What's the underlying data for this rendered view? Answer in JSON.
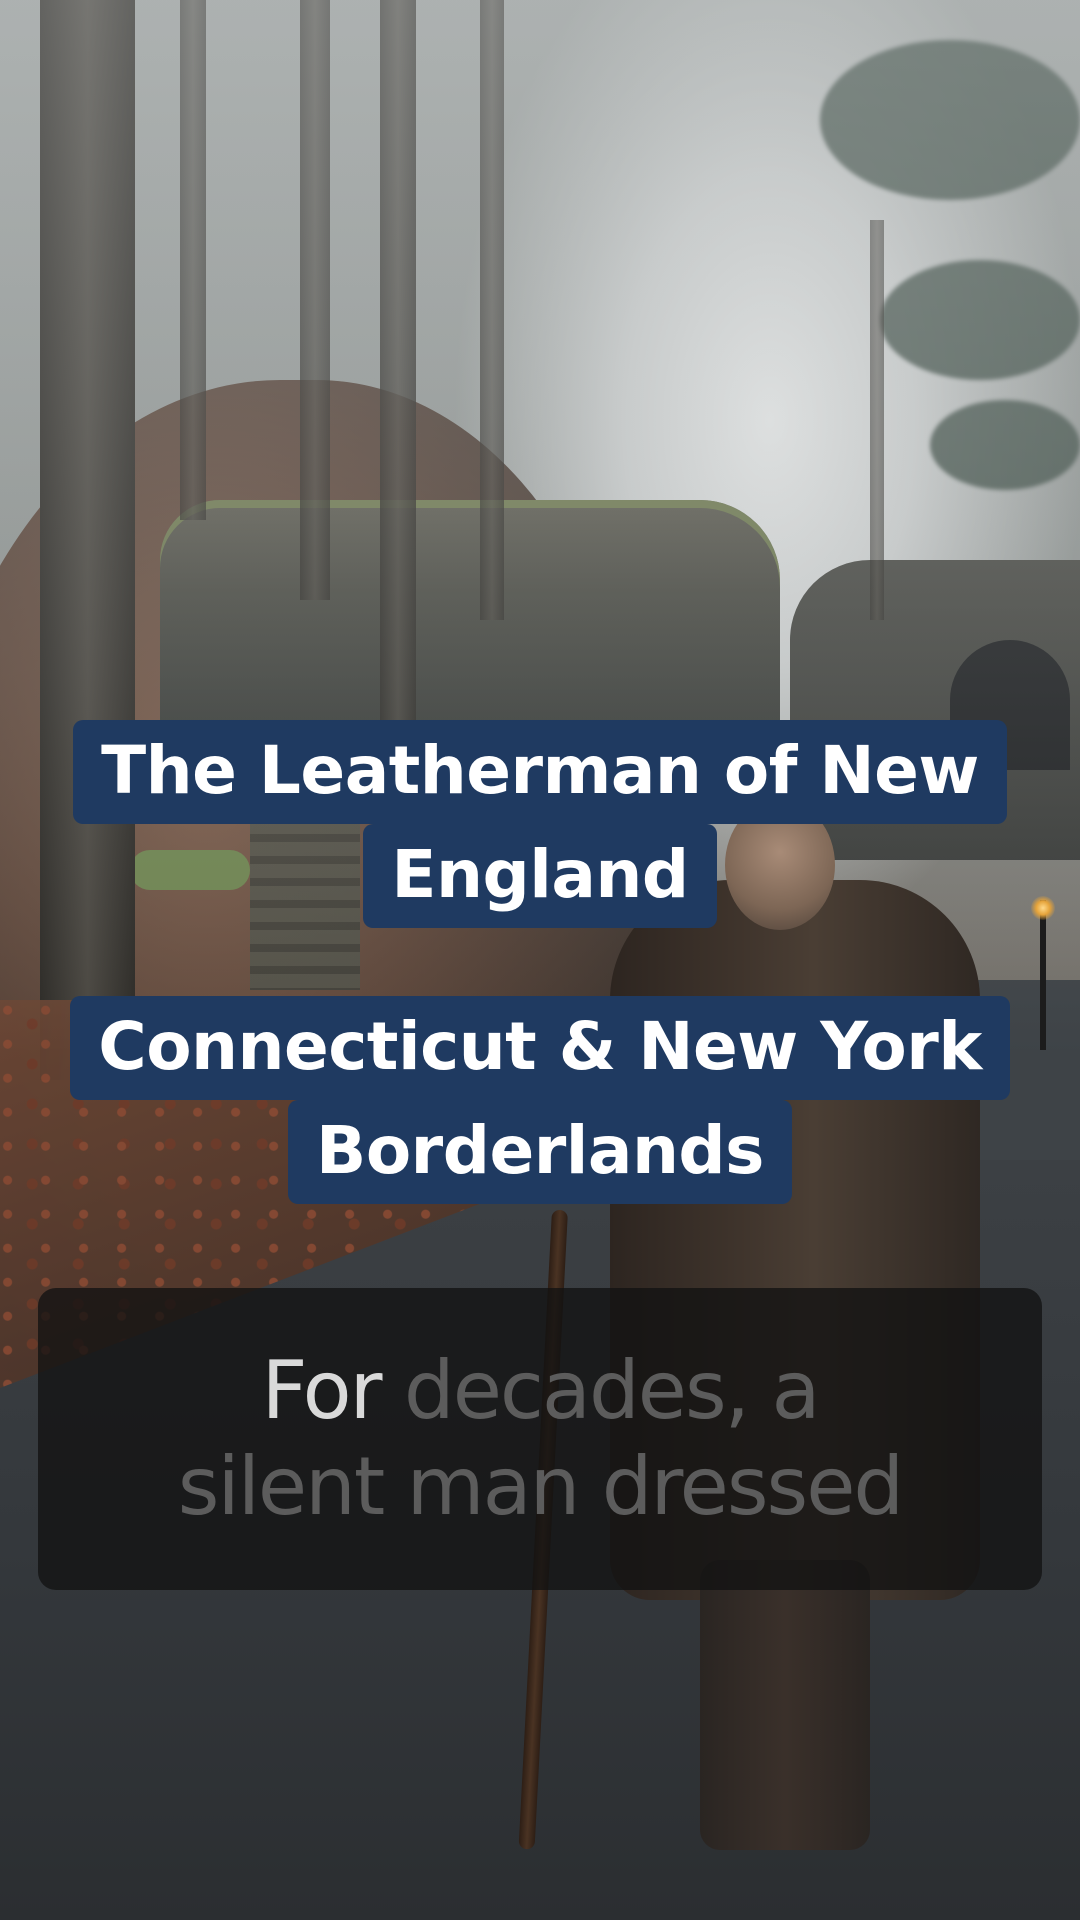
{
  "title_card": {
    "line1": "The Leatherman of New",
    "line2": "England"
  },
  "location_card": {
    "line1": "Connecticut & New York",
    "line2": "Borderlands"
  },
  "caption": {
    "spoken_word": "For",
    "line1_rest": " decades, a",
    "line2": "silent man dressed"
  },
  "colors": {
    "title_bg": "#1f3a61",
    "title_text": "#ffffff",
    "caption_active": "#d9d9d9",
    "caption_pending": "#5c5c5c"
  }
}
